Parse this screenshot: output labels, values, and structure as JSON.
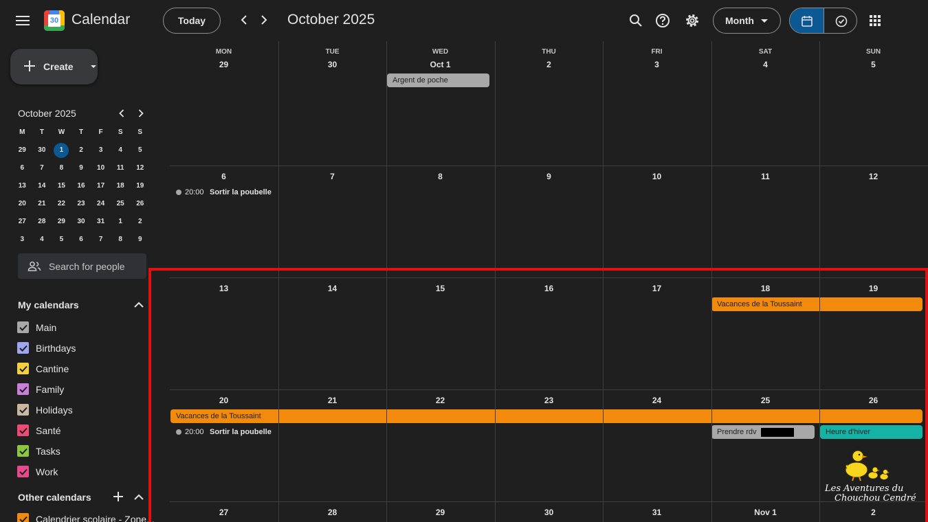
{
  "app": {
    "title": "Calendar",
    "logo_number": "30"
  },
  "header": {
    "today_label": "Today",
    "month_title": "October 2025",
    "view_label": "Month"
  },
  "sidebar": {
    "create_label": "Create",
    "mini_cal": {
      "title": "October 2025",
      "weekdays": [
        "M",
        "T",
        "W",
        "T",
        "F",
        "S",
        "S"
      ],
      "weeks": [
        [
          "29",
          "30",
          "1",
          "2",
          "3",
          "4",
          "5"
        ],
        [
          "6",
          "7",
          "8",
          "9",
          "10",
          "11",
          "12"
        ],
        [
          "13",
          "14",
          "15",
          "16",
          "17",
          "18",
          "19"
        ],
        [
          "20",
          "21",
          "22",
          "23",
          "24",
          "25",
          "26"
        ],
        [
          "27",
          "28",
          "29",
          "30",
          "31",
          "1",
          "2"
        ],
        [
          "3",
          "4",
          "5",
          "6",
          "7",
          "8",
          "9"
        ]
      ],
      "selected": "1"
    },
    "search_people": "Search for people",
    "my_calendars_title": "My calendars",
    "my_calendars": [
      {
        "name": "Main",
        "color": "#a8a8a8"
      },
      {
        "name": "Birthdays",
        "color": "#a1a4f0"
      },
      {
        "name": "Cantine",
        "color": "#f4d03f"
      },
      {
        "name": "Family",
        "color": "#c97fd8"
      },
      {
        "name": "Holidays",
        "color": "#c8b8a0"
      },
      {
        "name": "Santé",
        "color": "#ee4a77"
      },
      {
        "name": "Tasks",
        "color": "#8cc63f"
      },
      {
        "name": "Work",
        "color": "#e8498a"
      }
    ],
    "other_calendars_title": "Other calendars",
    "other_calendars": [
      {
        "name": "Calendrier scolaire - Zone...",
        "color": "#f28b0b"
      }
    ]
  },
  "grid": {
    "weekdays": [
      "MON",
      "TUE",
      "WED",
      "THU",
      "FRI",
      "SAT",
      "SUN"
    ],
    "weeks": [
      [
        "29",
        "30",
        "Oct 1",
        "2",
        "3",
        "4",
        "5"
      ],
      [
        "6",
        "7",
        "8",
        "9",
        "10",
        "11",
        "12"
      ],
      [
        "13",
        "14",
        "15",
        "16",
        "17",
        "18",
        "19"
      ],
      [
        "20",
        "21",
        "22",
        "23",
        "24",
        "25",
        "26"
      ],
      [
        "27",
        "28",
        "29",
        "30",
        "31",
        "Nov 1",
        "2"
      ]
    ],
    "events": {
      "argent": "Argent de poche",
      "poubelle_time_1": "20:00",
      "poubelle_title_1": "Sortir la poubelle",
      "vacances_1": "Vacances de la Toussaint",
      "vacances_2": "Vacances de la Toussaint",
      "poubelle_time_2": "20:00",
      "poubelle_title_2": "Sortir la poubelle",
      "rdv": "Prendre rdv",
      "heure_hiver": "Heure d'hiver"
    },
    "colors": {
      "gray": "#a8a8a8",
      "orange": "#f28b0b",
      "teal": "#15b3a6",
      "highlight": "#e0110f"
    }
  },
  "watermark": {
    "line1": "Les Aventures du",
    "line2": "Chouchou Cendré"
  }
}
